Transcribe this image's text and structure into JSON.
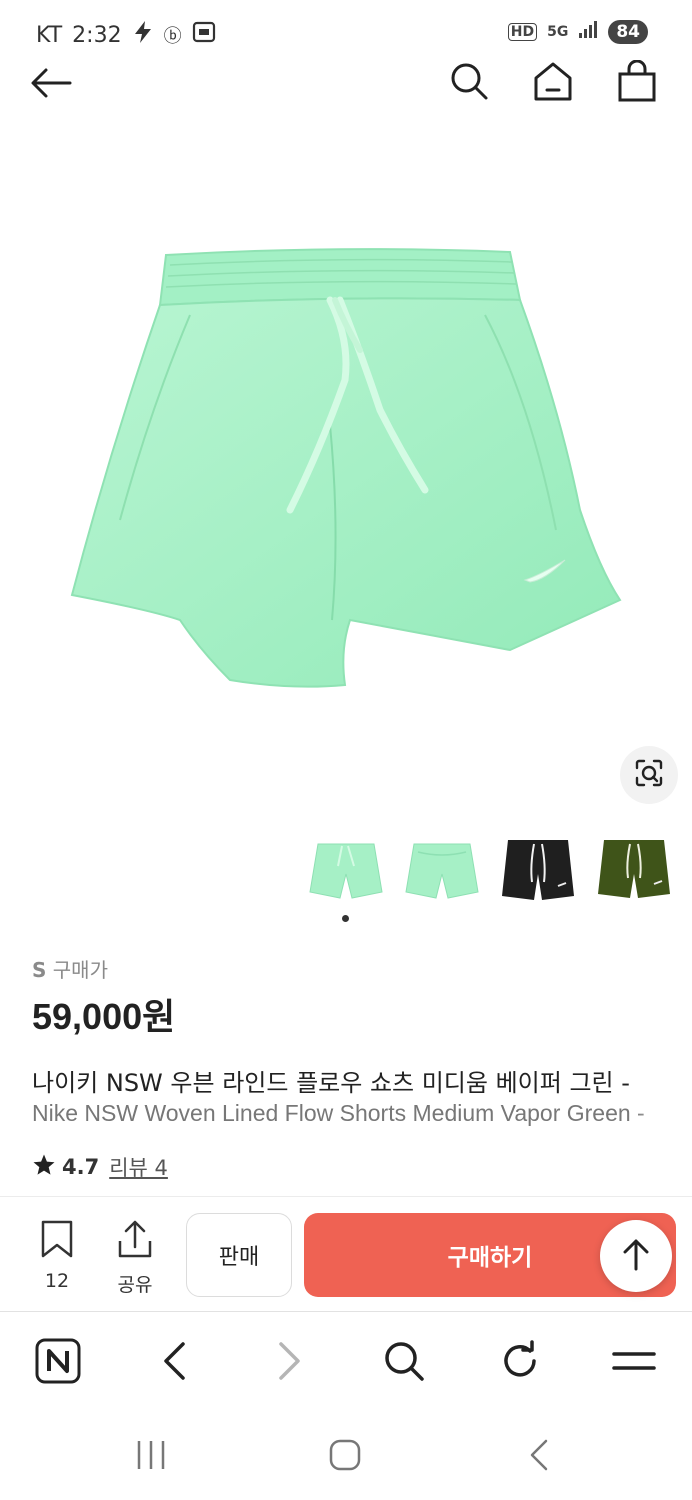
{
  "status_bar": {
    "carrier": "KT",
    "time": "2:32",
    "battery": "84",
    "hd": "HD",
    "network": "5G"
  },
  "gallery": {
    "image_alt": "",
    "thumbnails": [
      "mint-front",
      "mint-back",
      "black",
      "olive"
    ],
    "active_index": 0
  },
  "product": {
    "size_prefix": "S",
    "price_label": "구매가",
    "price": "59,000원",
    "title_ko": "나이키 NSW 우븐 라인드 플로우 쇼츠 미디움 베이퍼 그린 -",
    "title_en": "Nike NSW Woven Lined Flow Shorts Medium Vapor Green -",
    "rating": "4.7",
    "reviews": "리뷰 4"
  },
  "actions": {
    "bookmark_count": "12",
    "share_label": "공유",
    "sell_label": "판매",
    "buy_label": "구매하기"
  },
  "colors": {
    "buy": "#ef6253",
    "mint": "#a6f0c6",
    "black": "#1f1f1f",
    "olive": "#3f5419"
  },
  "icons": [
    "back-icon",
    "search-icon",
    "home-icon",
    "cart-icon",
    "lens-icon",
    "bookmark-icon",
    "share-icon",
    "arrow-up-icon",
    "naver-icon",
    "browser-back-icon",
    "browser-forward-icon",
    "browser-search-icon",
    "refresh-icon",
    "menu-icon",
    "recent-apps-icon",
    "home-nav-icon",
    "system-back-icon"
  ]
}
